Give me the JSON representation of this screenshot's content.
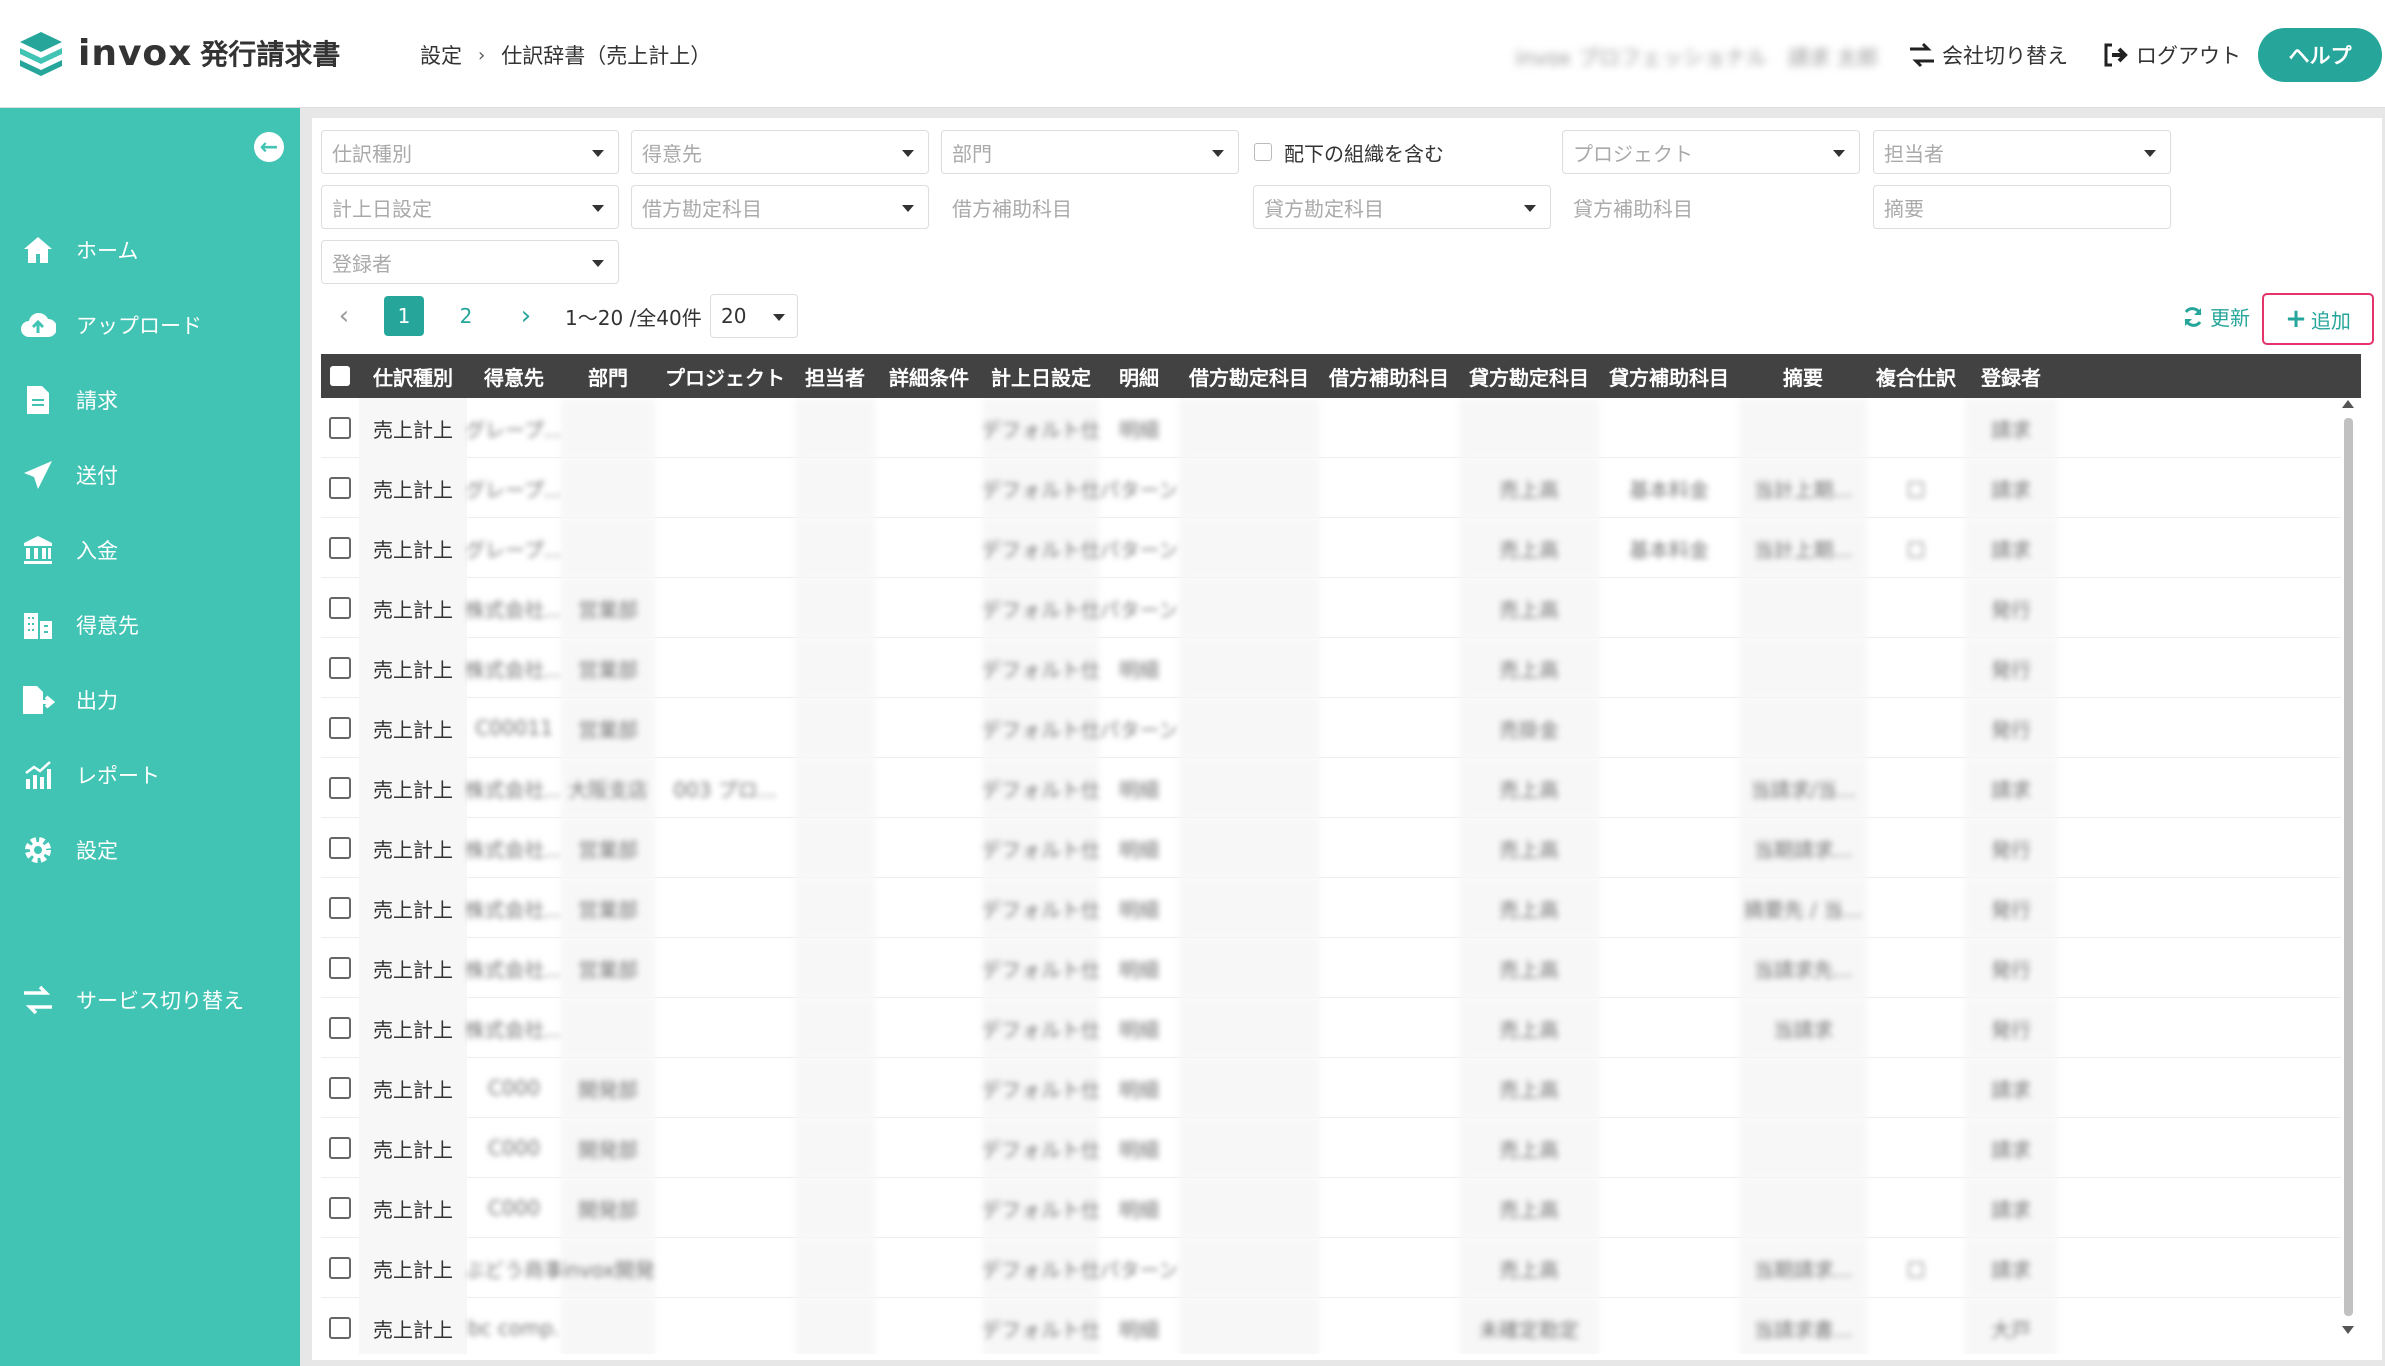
{
  "header": {
    "logo_text": "invox",
    "logo_sub": "発行請求書",
    "breadcrumb": [
      "設定",
      "仕訳辞書（売上計上）"
    ],
    "user_name": "invox プロフェッショナル　請求 太郎",
    "switch_company": "会社切り替え",
    "logout": "ログアウト",
    "help": "ヘルプ"
  },
  "sidebar": {
    "items": [
      {
        "label": "ホーム",
        "icon": "home-icon"
      },
      {
        "label": "アップロード",
        "icon": "cloud-upload-icon"
      },
      {
        "label": "請求",
        "icon": "document-icon"
      },
      {
        "label": "送付",
        "icon": "send-icon"
      },
      {
        "label": "入金",
        "icon": "bank-icon"
      },
      {
        "label": "得意先",
        "icon": "building-icon"
      },
      {
        "label": "出力",
        "icon": "export-icon"
      },
      {
        "label": "レポート",
        "icon": "report-icon"
      },
      {
        "label": "設定",
        "icon": "gear-icon"
      },
      {
        "label": "サービス切り替え",
        "icon": "switch-icon"
      }
    ]
  },
  "filters": {
    "journal_type": "仕訳種別",
    "customer": "得意先",
    "department": "部門",
    "include_sub": "配下の組織を含む",
    "project": "プロジェクト",
    "assignee": "担当者",
    "date_setting": "計上日設定",
    "debit_account": "借方勘定科目",
    "debit_sub": "借方補助科目",
    "credit_account": "貸方勘定科目",
    "credit_sub": "貸方補助科目",
    "summary": "摘要",
    "registrant": "登録者"
  },
  "pager": {
    "pages": [
      "1",
      "2"
    ],
    "info": "1〜20 /全40件",
    "page_size": "20"
  },
  "actions": {
    "refresh": "更新",
    "add": "追加"
  },
  "table": {
    "headers": [
      "仕訳種別",
      "得意先",
      "部門",
      "プロジェクト",
      "担当者",
      "詳細条件",
      "計上日設定",
      "明細",
      "借方勘定科目",
      "借方補助科目",
      "貸方勘定科目",
      "貸方補助科目",
      "摘要",
      "複合仕訳",
      "登録者"
    ],
    "rows": [
      {
        "type": "売上計上",
        "customer": "グレープ...",
        "dept": "",
        "project": "",
        "date": "デフォルト仕",
        "detail": "明細",
        "credit": "",
        "credit_sub": "",
        "summary": "",
        "compound": "",
        "user": "請求"
      },
      {
        "type": "売上計上",
        "customer": "グレープ...",
        "dept": "",
        "project": "",
        "date": "デフォルト仕",
        "detail": "パターン",
        "credit": "売上高",
        "credit_sub": "基本料金",
        "summary": "当計上期...",
        "compound": "□",
        "user": "請求"
      },
      {
        "type": "売上計上",
        "customer": "グレープ...",
        "dept": "",
        "project": "",
        "date": "デフォルト仕",
        "detail": "パターン",
        "credit": "売上高",
        "credit_sub": "基本料金",
        "summary": "当計上期...",
        "compound": "□",
        "user": "請求"
      },
      {
        "type": "売上計上",
        "customer": "株式会社...",
        "dept": "営業部",
        "project": "",
        "date": "デフォルト仕",
        "detail": "パターン",
        "credit": "売上高",
        "credit_sub": "",
        "summary": "",
        "compound": "",
        "user": "発行"
      },
      {
        "type": "売上計上",
        "customer": "株式会社...",
        "dept": "営業部",
        "project": "",
        "date": "デフォルト仕",
        "detail": "明細",
        "credit": "売上高",
        "credit_sub": "",
        "summary": "",
        "compound": "",
        "user": "発行"
      },
      {
        "type": "売上計上",
        "customer": "C00011",
        "dept": "営業部",
        "project": "",
        "date": "デフォルト仕",
        "detail": "パターン",
        "credit": "売掛金",
        "credit_sub": "",
        "summary": "",
        "compound": "",
        "user": "発行"
      },
      {
        "type": "売上計上",
        "customer": "株式会社...",
        "dept": "大阪支店",
        "project": "003 プロ...",
        "date": "デフォルト仕",
        "detail": "明細",
        "credit": "売上高",
        "credit_sub": "",
        "summary": "当請求/当...",
        "compound": "",
        "user": "請求"
      },
      {
        "type": "売上計上",
        "customer": "株式会社...",
        "dept": "営業部",
        "project": "",
        "date": "デフォルト仕",
        "detail": "明細",
        "credit": "売上高",
        "credit_sub": "",
        "summary": "当期請求...",
        "compound": "",
        "user": "発行"
      },
      {
        "type": "売上計上",
        "customer": "株式会社...",
        "dept": "営業部",
        "project": "",
        "date": "デフォルト仕",
        "detail": "明細",
        "credit": "売上高",
        "credit_sub": "",
        "summary": "摘要先 / 当...",
        "compound": "",
        "user": "発行"
      },
      {
        "type": "売上計上",
        "customer": "株式会社...",
        "dept": "営業部",
        "project": "",
        "date": "デフォルト仕",
        "detail": "明細",
        "credit": "売上高",
        "credit_sub": "",
        "summary": "当請求先...",
        "compound": "",
        "user": "発行"
      },
      {
        "type": "売上計上",
        "customer": "株式会社...",
        "dept": "",
        "project": "",
        "date": "デフォルト仕",
        "detail": "明細",
        "credit": "売上高",
        "credit_sub": "",
        "summary": "当請求",
        "compound": "",
        "user": "発行"
      },
      {
        "type": "売上計上",
        "customer": "C000",
        "dept": "開発部",
        "project": "",
        "date": "デフォルト仕",
        "detail": "明細",
        "credit": "売上高",
        "credit_sub": "",
        "summary": "",
        "compound": "",
        "user": "請求"
      },
      {
        "type": "売上計上",
        "customer": "C000",
        "dept": "開発部",
        "project": "",
        "date": "デフォルト仕",
        "detail": "明細",
        "credit": "売上高",
        "credit_sub": "",
        "summary": "",
        "compound": "",
        "user": "請求"
      },
      {
        "type": "売上計上",
        "customer": "C000",
        "dept": "開発部",
        "project": "",
        "date": "デフォルト仕",
        "detail": "明細",
        "credit": "売上高",
        "credit_sub": "",
        "summary": "",
        "compound": "",
        "user": "請求"
      },
      {
        "type": "売上計上",
        "customer": "ぶどう商事",
        "dept": "invox開発",
        "project": "",
        "date": "デフォルト仕",
        "detail": "パターン",
        "credit": "売上高",
        "credit_sub": "",
        "summary": "当期請求...",
        "compound": "□",
        "user": "請求"
      },
      {
        "type": "売上計上",
        "customer": "abc comp...",
        "dept": "",
        "project": "",
        "date": "デフォルト仕",
        "detail": "明細",
        "credit": "未確定勘定",
        "credit_sub": "",
        "summary": "当請求書...",
        "compound": "",
        "user": "大戸"
      }
    ]
  },
  "colors": {
    "brand": "#41c4b4",
    "accent": "#26a69a",
    "highlight": "#e5336b",
    "table_header": "#424242"
  }
}
